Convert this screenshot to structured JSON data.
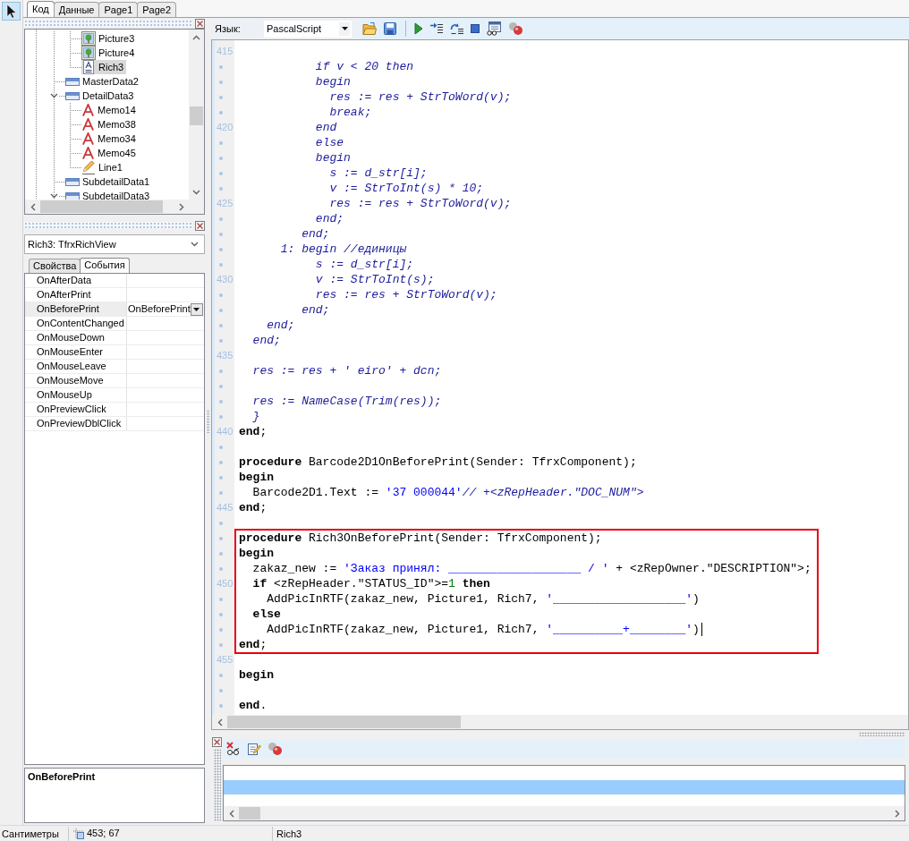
{
  "tool_palette": {
    "tools": [
      {
        "kind": "pointer",
        "selected": true
      }
    ]
  },
  "page_tabs": [
    {
      "label": "Код",
      "selected": true
    },
    {
      "label": "Данные",
      "selected": false
    },
    {
      "label": "Page1",
      "selected": false
    },
    {
      "label": "Page2",
      "selected": false
    }
  ],
  "object_tree": {
    "items": [
      {
        "children": [
          {
            "label": "Picture3",
            "kind": "picture",
            "selected": false
          },
          {
            "label": "Picture4",
            "kind": "picture",
            "selected": false
          },
          {
            "label": "Rich3",
            "kind": "rich_text",
            "selected": true
          }
        ]
      },
      {
        "label": "MasterData2",
        "kind": "band",
        "selected": false
      },
      {
        "label": "DetailData3",
        "kind": "band",
        "selected": false,
        "expanded": true,
        "children": [
          {
            "label": "Memo14",
            "kind": "memo",
            "selected": false
          },
          {
            "label": "Memo38",
            "kind": "memo",
            "selected": false
          },
          {
            "label": "Memo34",
            "kind": "memo",
            "selected": false
          },
          {
            "label": "Memo45",
            "kind": "memo",
            "selected": false
          },
          {
            "label": "Line1",
            "kind": "line",
            "selected": false
          }
        ]
      },
      {
        "label": "SubdetailData1",
        "kind": "band",
        "selected": false
      },
      {
        "label": "SubdetailData3",
        "kind": "band",
        "selected": false,
        "expanded": true
      }
    ]
  },
  "object_selector": {
    "value": "Rich3: TfrxRichView"
  },
  "inspector_tabs": [
    {
      "label": "Свойства",
      "selected": false
    },
    {
      "label": "События",
      "selected": true
    }
  ],
  "properties": [
    {
      "name": "OnAfterData",
      "selected": false
    },
    {
      "name": "OnAfterPrint",
      "selected": false
    },
    {
      "name": "OnBeforePrint",
      "value": "OnBeforePrint",
      "selected": true
    },
    {
      "name": "OnContentChanged",
      "selected": false
    },
    {
      "name": "OnMouseDown",
      "selected": false
    },
    {
      "name": "OnMouseEnter",
      "selected": false
    },
    {
      "name": "OnMouseLeave",
      "selected": false
    },
    {
      "name": "OnMouseMove",
      "selected": false
    },
    {
      "name": "OnMouseUp",
      "selected": false
    },
    {
      "name": "OnPreviewClick",
      "selected": false
    },
    {
      "name": "OnPreviewDblClick",
      "selected": false
    }
  ],
  "property_description": {
    "title": "OnBeforePrint"
  },
  "code_toolbar": {
    "label": "Язык:",
    "language": "PascalScript"
  },
  "code_editor": {
    "blocks": [
      {
        "kind": "plain",
        "lines": [
          {
            "kind": "number",
            "number": "415"
          },
          {
            "kind": "dot",
            "tokens": [
              {
                "kind": "comment",
                "text": "           if v < 20 then"
              }
            ]
          },
          {
            "kind": "dot",
            "tokens": [
              {
                "kind": "comment",
                "text": "           begin"
              }
            ]
          },
          {
            "kind": "dot",
            "tokens": [
              {
                "kind": "comment",
                "text": "             res := res + StrToWord(v);"
              }
            ]
          },
          {
            "kind": "dot",
            "tokens": [
              {
                "kind": "comment",
                "text": "             break;"
              }
            ]
          },
          {
            "kind": "number",
            "number": "420",
            "tokens": [
              {
                "kind": "comment",
                "text": "           end"
              }
            ]
          },
          {
            "kind": "dot",
            "tokens": [
              {
                "kind": "comment",
                "text": "           else"
              }
            ]
          },
          {
            "kind": "dot",
            "tokens": [
              {
                "kind": "comment",
                "text": "           begin"
              }
            ]
          },
          {
            "kind": "dot",
            "tokens": [
              {
                "kind": "comment",
                "text": "             s := d_str[i];"
              }
            ]
          },
          {
            "kind": "dot",
            "tokens": [
              {
                "kind": "comment",
                "text": "             v := StrToInt(s) * 10;"
              }
            ]
          },
          {
            "kind": "number",
            "number": "425",
            "tokens": [
              {
                "kind": "comment",
                "text": "             res := res + StrToWord(v);"
              }
            ]
          },
          {
            "kind": "dot",
            "tokens": [
              {
                "kind": "comment",
                "text": "           end;"
              }
            ]
          },
          {
            "kind": "dot",
            "tokens": [
              {
                "kind": "comment",
                "text": "         end;"
              }
            ]
          },
          {
            "kind": "dot",
            "tokens": [
              {
                "kind": "comment",
                "text": "      1: begin //единицы"
              }
            ]
          },
          {
            "kind": "dot",
            "tokens": [
              {
                "kind": "comment",
                "text": "           s := d_str[i];"
              }
            ]
          },
          {
            "kind": "number",
            "number": "430",
            "tokens": [
              {
                "kind": "comment",
                "text": "           v := StrToInt(s);"
              }
            ]
          },
          {
            "kind": "dot",
            "tokens": [
              {
                "kind": "comment",
                "text": "           res := res + StrToWord(v);"
              }
            ]
          },
          {
            "kind": "dot",
            "tokens": [
              {
                "kind": "comment",
                "text": "         end;"
              }
            ]
          },
          {
            "kind": "dot",
            "tokens": [
              {
                "kind": "comment",
                "text": "    end;"
              }
            ]
          },
          {
            "kind": "dot",
            "tokens": [
              {
                "kind": "comment",
                "text": "  end;"
              }
            ]
          },
          {
            "kind": "number",
            "number": "435"
          },
          {
            "kind": "dot",
            "tokens": [
              {
                "kind": "comment",
                "text": "  res := res + ' eiro' + dcn;"
              }
            ]
          },
          {
            "kind": "dot"
          },
          {
            "kind": "dot",
            "tokens": [
              {
                "kind": "comment",
                "text": "  res := NameCase(Trim(res));"
              }
            ]
          },
          {
            "kind": "dot",
            "tokens": [
              {
                "kind": "comment",
                "text": "  }"
              }
            ]
          },
          {
            "kind": "number",
            "number": "440",
            "tokens": [
              {
                "kind": "keyword",
                "text": "end"
              },
              {
                "kind": "plain",
                "text": ";"
              }
            ]
          },
          {
            "kind": "dot"
          },
          {
            "kind": "dot",
            "tokens": [
              {
                "kind": "keyword",
                "text": "procedure"
              },
              {
                "kind": "plain",
                "text": " Barcode2D1OnBeforePrint(Sender: TfrxComponent);"
              }
            ]
          },
          {
            "kind": "dot",
            "tokens": [
              {
                "kind": "keyword",
                "text": "begin"
              }
            ]
          },
          {
            "kind": "dot",
            "tokens": [
              {
                "kind": "plain",
                "text": "  Barcode2D1.Text := "
              },
              {
                "kind": "string",
                "text": "'37 000044'"
              },
              {
                "kind": "comment",
                "text": "// +<zRepHeader.\"DOC_NUM\">"
              }
            ]
          },
          {
            "kind": "number",
            "number": "445",
            "tokens": [
              {
                "kind": "keyword",
                "text": "end"
              },
              {
                "kind": "plain",
                "text": ";"
              }
            ]
          },
          {
            "kind": "dot"
          }
        ]
      },
      {
        "kind": "boxed",
        "lines": [
          {
            "kind": "dot",
            "tokens": [
              {
                "kind": "keyword",
                "text": "procedure"
              },
              {
                "kind": "plain",
                "text": " Rich3OnBeforePrint(Sender: TfrxComponent);"
              }
            ]
          },
          {
            "kind": "dot",
            "tokens": [
              {
                "kind": "keyword",
                "text": "begin"
              }
            ]
          },
          {
            "kind": "dot",
            "tokens": [
              {
                "kind": "plain",
                "text": "  zakaz_new := "
              },
              {
                "kind": "string",
                "text": "'Заказ принял: ___________________ / '"
              },
              {
                "kind": "plain",
                "text": " + <zRepOwner.\"DESCRIPTION\">;"
              }
            ]
          },
          {
            "kind": "number",
            "number": "450",
            "tokens": [
              {
                "kind": "keyword",
                "text": "  if"
              },
              {
                "kind": "plain",
                "text": " <zRepHeader.\"STATUS_ID\">="
              },
              {
                "kind": "number",
                "text": "1"
              },
              {
                "kind": "keyword",
                "text": " then"
              }
            ]
          },
          {
            "kind": "dot",
            "tokens": [
              {
                "kind": "plain",
                "text": "    AddPicInRTF(zakaz_new, Picture1, Rich7, "
              },
              {
                "kind": "string",
                "text": "'___________________'"
              },
              {
                "kind": "plain",
                "text": ")"
              }
            ]
          },
          {
            "kind": "dot",
            "tokens": [
              {
                "kind": "keyword",
                "text": "  else"
              }
            ]
          },
          {
            "kind": "dot",
            "tokens": [
              {
                "kind": "plain",
                "text": "    AddPicInRTF(zakaz_new, Picture1, Rich7, "
              },
              {
                "kind": "string",
                "text": "'__________+________'"
              },
              {
                "kind": "plain",
                "text": ")"
              },
              {
                "kind": "cursor"
              }
            ]
          },
          {
            "kind": "dot",
            "tokens": [
              {
                "kind": "keyword",
                "text": "end"
              },
              {
                "kind": "plain",
                "text": ";"
              }
            ]
          }
        ]
      },
      {
        "kind": "plain",
        "lines": [
          {
            "kind": "number",
            "number": "455"
          },
          {
            "kind": "dot",
            "tokens": [
              {
                "kind": "keyword",
                "text": "begin"
              }
            ]
          },
          {
            "kind": "dot"
          },
          {
            "kind": "dot",
            "tokens": [
              {
                "kind": "keyword",
                "text": "end"
              },
              {
                "kind": "plain",
                "text": "."
              }
            ]
          }
        ]
      }
    ]
  },
  "watch_list": {
    "rows": [
      {
        "selected": false
      },
      {
        "selected": true
      }
    ]
  },
  "status_bar": {
    "units": "Сантиметры",
    "position": "453; 67",
    "object": "Rich3"
  }
}
